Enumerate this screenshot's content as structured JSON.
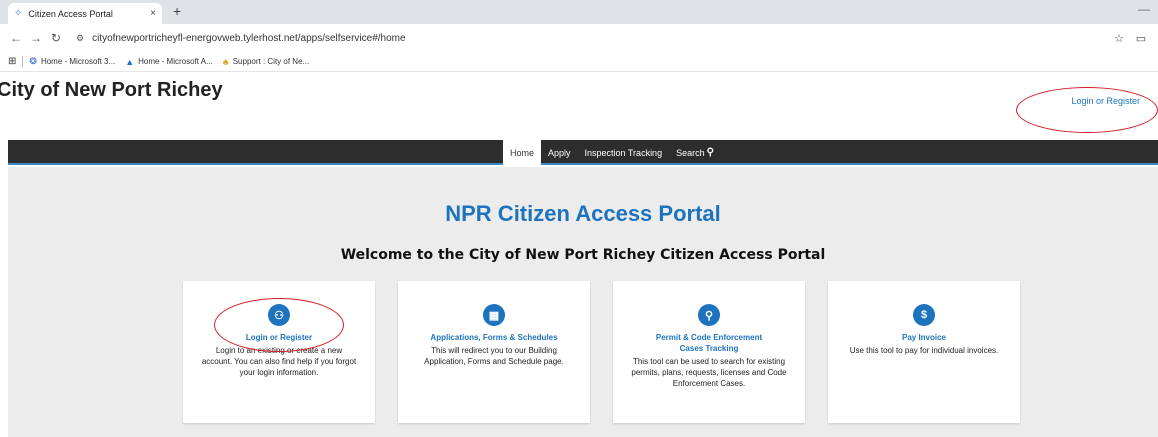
{
  "browser": {
    "tab_title": "Citizen Access Portal",
    "tab_close": "×",
    "new_tab": "+",
    "url": "cityofnewportricheyfl-energovweb.tylerhost.net/apps/selfservice#/home",
    "bookmarks": [
      {
        "label": "Home - Microsoft 3..."
      },
      {
        "label": "Home - Microsoft A..."
      },
      {
        "label": "Support : City of Ne..."
      }
    ]
  },
  "header": {
    "site_title": "City of New Port Richey",
    "login_link": "Login or Register"
  },
  "nav": {
    "items": [
      {
        "label": "Home"
      },
      {
        "label": "Apply"
      },
      {
        "label": "Inspection Tracking"
      },
      {
        "label": "Search"
      }
    ]
  },
  "main": {
    "title": "NPR Citizen Access Portal",
    "subtitle": "Welcome to the City of New Port Richey Citizen Access Portal",
    "cards": [
      {
        "title": "Login or Register",
        "desc": "Login to an existing or create a new account. You can also find help if you forgot your login information.",
        "icon": "users-icon"
      },
      {
        "title": "Applications, Forms & Schedules",
        "desc": "This will redirect you to our Building Application, Forms and Schedule page.",
        "icon": "building-icon"
      },
      {
        "title": "Permit & Code Enforcement Cases Tracking",
        "desc": "This tool can be used to search for existing permits, plans, requests, licenses and Code Enforcement Cases.",
        "icon": "search-icon"
      },
      {
        "title": "Pay Invoice",
        "desc": "Use this tool to pay for individual invoices.",
        "icon": "dollar-icon"
      }
    ]
  },
  "colors": {
    "accent": "#1e73be",
    "navbar": "#2d2d2d",
    "annotation": "#d21f26",
    "page_bg": "#ececec"
  }
}
